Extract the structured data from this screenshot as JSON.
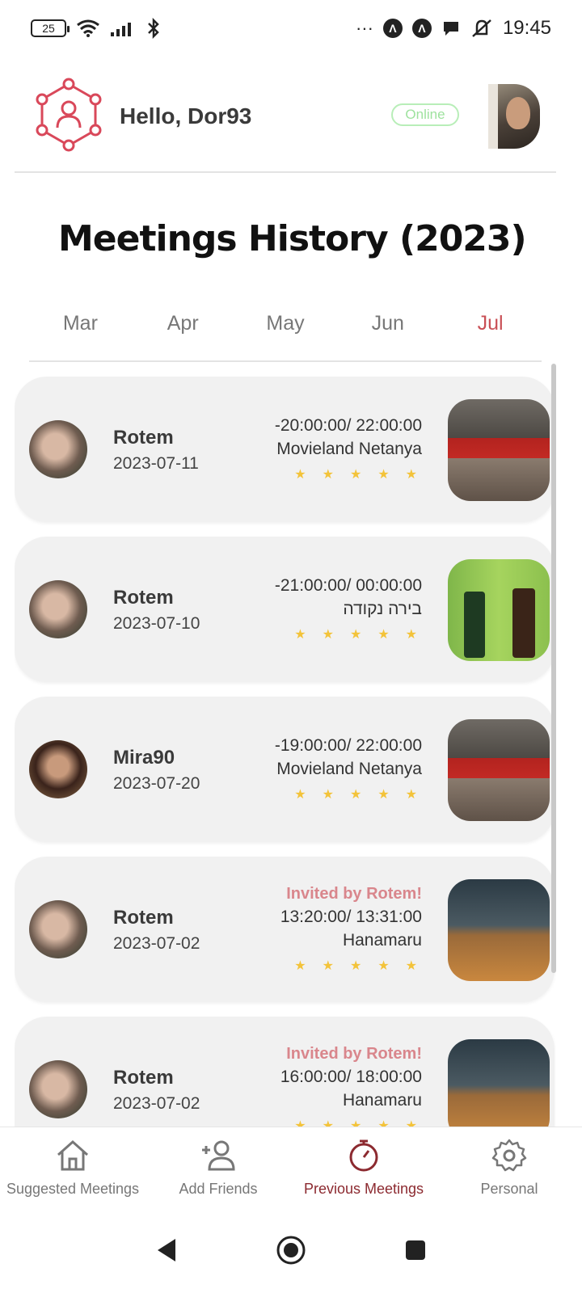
{
  "status_bar": {
    "battery": "25",
    "dots": "···",
    "time": "19:45",
    "icons": [
      "wifi-icon",
      "signal-icon",
      "bluetooth-icon",
      "app-a-icon",
      "app-a-icon",
      "chat-icon",
      "mute-icon"
    ]
  },
  "header": {
    "greeting": "Hello, Dor93",
    "status": "Online"
  },
  "page_title": "Meetings History (2023)",
  "months": {
    "items": [
      "Mar",
      "Apr",
      "May",
      "Jun",
      "Jul"
    ],
    "active": "Jul"
  },
  "meetings": [
    {
      "name": "Rotem",
      "date": "2023-07-11",
      "invited": "",
      "time": "-20:00:00/ 22:00:00",
      "place": "Movieland Netanya",
      "rating": 5,
      "image": "cinema"
    },
    {
      "name": "Rotem",
      "date": "2023-07-10",
      "invited": "",
      "time": "-21:00:00/ 00:00:00",
      "place": "בירה נקודה",
      "rating": 5,
      "image": "beer"
    },
    {
      "name": "Mira90",
      "date": "2023-07-20",
      "invited": "",
      "time": "-19:00:00/ 22:00:00",
      "place": "Movieland Netanya",
      "rating": 5,
      "image": "cinema"
    },
    {
      "name": "Rotem",
      "date": "2023-07-02",
      "invited": "Invited by Rotem!",
      "time": "13:20:00/ 13:31:00",
      "place": "Hanamaru",
      "rating": 5,
      "image": "bar"
    },
    {
      "name": "Rotem",
      "date": "2023-07-02",
      "invited": "Invited by Rotem!",
      "time": "16:00:00/ 18:00:00",
      "place": "Hanamaru",
      "rating": 5,
      "image": "bar"
    }
  ],
  "bottom_nav": {
    "items": [
      {
        "label": "Suggested Meetings",
        "icon": "home-icon"
      },
      {
        "label": "Add Friends",
        "icon": "add-user-icon"
      },
      {
        "label": "Previous Meetings",
        "icon": "timer-icon"
      },
      {
        "label": "Personal",
        "icon": "gear-icon"
      }
    ],
    "active": "Previous Meetings"
  },
  "colors": {
    "accent": "#c94f55",
    "active_nav": "#8c2a30",
    "invited": "#d9868c",
    "star": "#f3c33a",
    "online": "#9ee29e",
    "card_bg": "#f1f1f1"
  }
}
